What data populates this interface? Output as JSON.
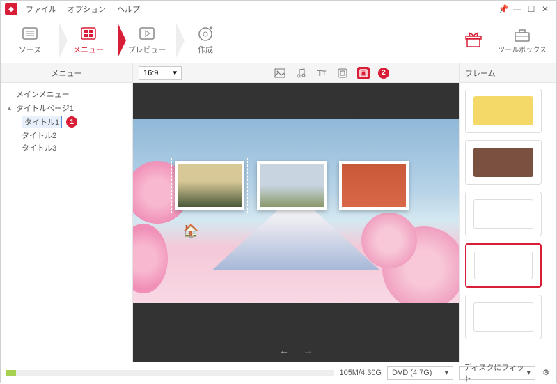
{
  "menubar": {
    "file": "ファイル",
    "option": "オプション",
    "help": "ヘルプ"
  },
  "steps": {
    "source": "ソース",
    "menu": "メニュー",
    "preview": "プレビュー",
    "create": "作成"
  },
  "tools": {
    "gift": "",
    "toolbox": "ツールボックス"
  },
  "subheader": {
    "left": "メニュー",
    "ratio": "16:9",
    "right": "フレーム",
    "badge2": "2"
  },
  "tree": {
    "main_menu": "メインメニュー",
    "title_page": "タイトルページ1",
    "titles": [
      "タイトル1",
      "タイトル2",
      "タイトル3"
    ],
    "badge1": "1"
  },
  "frames": [
    {
      "color": "#f4d868",
      "selected": false
    },
    {
      "color": "#7a5040",
      "selected": false
    },
    {
      "color": "#ffffff",
      "selected": false
    },
    {
      "color": "#ffffff",
      "selected": true
    },
    {
      "color": "#ffffff",
      "selected": false
    }
  ],
  "status": {
    "size": "105M/4.30G",
    "disc": "DVD (4.7G)",
    "fit": "ディスクにフィット"
  }
}
